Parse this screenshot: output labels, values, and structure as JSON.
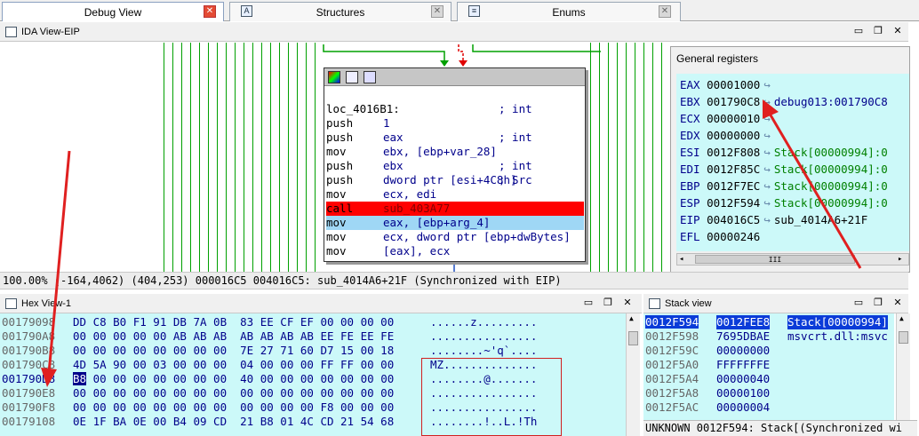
{
  "tabs": [
    {
      "label": "Debug View",
      "active": true
    },
    {
      "label": "Structures",
      "active": false
    },
    {
      "label": "Enums",
      "active": false
    }
  ],
  "ida_view": {
    "title": "IDA View-EIP",
    "status": "100.00% (-164,4062) (404,253) 000016C5 004016C5: sub_4014A6+21F (Synchronized with EIP)"
  },
  "graph_node": {
    "lines": [
      {
        "label": "loc_4016B1:",
        "mnemonic": "",
        "operand": "",
        "comment": "; int"
      },
      {
        "label": "",
        "mnemonic": "push",
        "operand": "1",
        "comment": ""
      },
      {
        "label": "",
        "mnemonic": "push",
        "operand": "eax",
        "comment": "; int"
      },
      {
        "label": "",
        "mnemonic": "mov",
        "operand": "ebx, [ebp+var_28]",
        "comment": ""
      },
      {
        "label": "",
        "mnemonic": "push",
        "operand": "ebx",
        "comment": "; int"
      },
      {
        "label": "",
        "mnemonic": "push",
        "operand": "dword ptr [esi+4C8h]",
        "comment": "; Src"
      },
      {
        "label": "",
        "mnemonic": "mov",
        "operand": "ecx, edi",
        "comment": ""
      },
      {
        "label": "",
        "mnemonic": "call",
        "operand": "sub_403A77",
        "comment": ""
      },
      {
        "label": "",
        "mnemonic": "mov",
        "operand": "eax, [ebp+arg_4]",
        "comment": ""
      },
      {
        "label": "",
        "mnemonic": "mov",
        "operand": "ecx, dword ptr [ebp+dwBytes]",
        "comment": ""
      },
      {
        "label": "",
        "mnemonic": "mov",
        "operand": "[eax], ecx",
        "comment": ""
      }
    ]
  },
  "registers": {
    "title": "General registers",
    "rows": [
      {
        "name": "EAX",
        "value": "00001000",
        "info": ""
      },
      {
        "name": "EBX",
        "value": "001790C8",
        "info": "debug013:001790C8"
      },
      {
        "name": "ECX",
        "value": "00000010",
        "info": ""
      },
      {
        "name": "EDX",
        "value": "00000000",
        "info": ""
      },
      {
        "name": "ESI",
        "value": "0012F808",
        "info": "Stack[00000994]:0"
      },
      {
        "name": "EDI",
        "value": "0012F85C",
        "info": "Stack[00000994]:0"
      },
      {
        "name": "EBP",
        "value": "0012F7EC",
        "info": "Stack[00000994]:0"
      },
      {
        "name": "ESP",
        "value": "0012F594",
        "info": "Stack[00000994]:0"
      },
      {
        "name": "EIP",
        "value": "004016C5",
        "info": "sub_4014A6+21F"
      },
      {
        "name": "EFL",
        "value": "00000246",
        "info": ""
      }
    ],
    "scroll_mark": "III"
  },
  "hex_view": {
    "title": "Hex View-1",
    "rows": [
      {
        "addr": "00179098",
        "bytes": "DD C8 B0 F1 91 DB 7A 0B  83 EE CF EF 00 00 00 00",
        "ascii": "......z........."
      },
      {
        "addr": "001790A8",
        "bytes": "00 00 00 00 00 AB AB AB  AB AB AB AB EE FE EE FE",
        "ascii": "................"
      },
      {
        "addr": "001790B8",
        "bytes": "00 00 00 00 00 00 00 00  7E 27 71 60 D7 15 00 18",
        "ascii": "........~'q`...."
      },
      {
        "addr": "001790C8",
        "bytes": "4D 5A 90 00 03 00 00 00  04 00 00 00 FF FF 00 00",
        "ascii": "MZ.............."
      },
      {
        "addr": "001790D8",
        "bytes": "B8 00 00 00 00 00 00 00  40 00 00 00 00 00 00 00",
        "ascii": "........@......."
      },
      {
        "addr": "001790E8",
        "bytes": "00 00 00 00 00 00 00 00  00 00 00 00 00 00 00 00",
        "ascii": "................"
      },
      {
        "addr": "001790F8",
        "bytes": "00 00 00 00 00 00 00 00  00 00 00 00 F8 00 00 00",
        "ascii": "................"
      },
      {
        "addr": "00179108",
        "bytes": "0E 1F BA 0E 00 B4 09 CD  21 B8 01 4C CD 21 54 68",
        "ascii": "........!..L.!Th"
      }
    ]
  },
  "stack_view": {
    "title": "Stack view",
    "rows": [
      {
        "addr": "0012F594",
        "value": "0012FEE8",
        "info": "Stack[00000994]"
      },
      {
        "addr": "0012F598",
        "value": "7695DBAE",
        "info": "msvcrt.dll:msvc"
      },
      {
        "addr": "0012F59C",
        "value": "00000000",
        "info": ""
      },
      {
        "addr": "0012F5A0",
        "value": "FFFFFFFE",
        "info": ""
      },
      {
        "addr": "0012F5A4",
        "value": "00000040",
        "info": ""
      },
      {
        "addr": "0012F5A8",
        "value": "00000100",
        "info": ""
      },
      {
        "addr": "0012F5AC",
        "value": "00000004",
        "info": ""
      }
    ],
    "status": "UNKNOWN 0012F594: Stack[(Synchronized wi"
  },
  "colors": {
    "accent_red": "#e02020",
    "panel_cyan": "#ccf9f9",
    "call_highlight": "#ff0000",
    "eip_highlight": "#9fd7f5",
    "graph_edge": "#00a000"
  }
}
